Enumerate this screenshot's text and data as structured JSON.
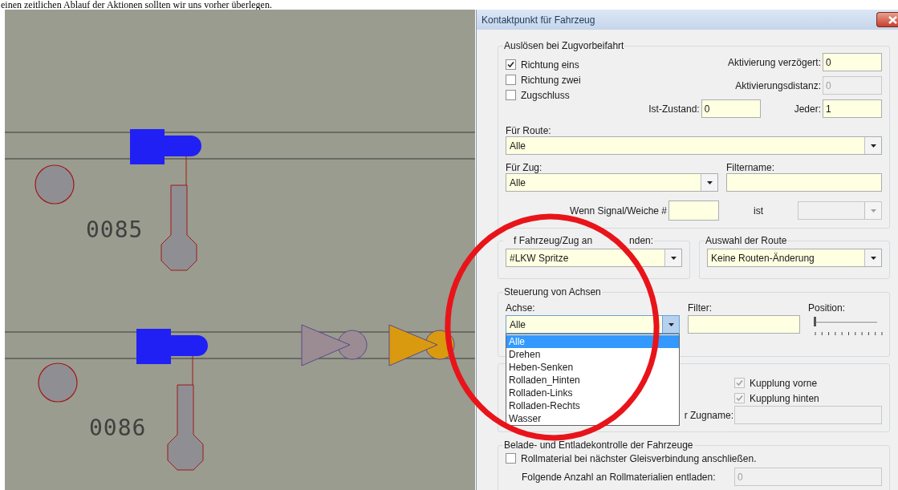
{
  "caption": "einen zeitlichen Ablauf der Aktionen sollten wir uns vorher überlegen.",
  "canvas": {
    "signals": [
      {
        "label": "0085"
      },
      {
        "label": "0086"
      }
    ],
    "markers": [
      {
        "color": "#9b8c93"
      },
      {
        "color": "#d99a10"
      }
    ]
  },
  "dialog": {
    "title": "Kontaktpunkt für Fahrzeug",
    "trigger": {
      "legend": "Auslösen bei Zugvorbeifahrt",
      "checkboxes": [
        {
          "label": "Richtung eins",
          "checked": true
        },
        {
          "label": "Richtung zwei",
          "checked": false
        },
        {
          "label": "Zugschluss",
          "checked": false
        }
      ],
      "fields": [
        {
          "label": "Aktivierung verzögert:",
          "value": "0",
          "disabled": false
        },
        {
          "label": "Aktivierungsdistanz:",
          "value": "0",
          "disabled": true
        },
        {
          "label": "Ist-Zustand:",
          "value": "0",
          "disabled": false
        },
        {
          "label": "Jeder:",
          "value": "1",
          "disabled": false
        }
      ],
      "route": {
        "label": "Für Route:",
        "value": "Alle"
      },
      "train": {
        "label": "Für Zug:",
        "value": "Alle"
      },
      "filter_name": {
        "label": "Filtername:"
      },
      "signal": {
        "label": "Wenn Signal/Weiche #",
        "state_label": "ist",
        "state_disabled": true
      }
    },
    "apply": {
      "legend_parts": [
        "f Fahrzeug/Zug an",
        "nden:"
      ],
      "value": "#LKW Spritze"
    },
    "route_choice": {
      "legend": "Auswahl der Route",
      "value": "Keine Routen-Änderung"
    },
    "axles": {
      "legend": "Steuerung von Achsen",
      "axle_label": "Achse:",
      "axle_value": "Alle",
      "expanded": true,
      "options": [
        {
          "label": "Alle",
          "selected": true
        },
        {
          "label": "Drehen",
          "selected": false
        },
        {
          "label": "Heben-Senken",
          "selected": false
        },
        {
          "label": "Rolladen_Hinten",
          "selected": false
        },
        {
          "label": "Rolladen-Links",
          "selected": false
        },
        {
          "label": "Rolladen-Rechts",
          "selected": false
        },
        {
          "label": "Wasser",
          "selected": false
        }
      ],
      "filter_label": "Filter:",
      "position_label": "Position:",
      "position": {
        "level": 0
      }
    },
    "coupling": {
      "checkboxes": [
        {
          "label": "Kupplung vorne",
          "checked": true,
          "disabled": true
        },
        {
          "label": "Kupplung hinten",
          "checked": true,
          "disabled": true
        }
      ],
      "name_label": "r Zugname:",
      "name_disabled": true
    },
    "loading": {
      "legend": "Belade- und Entladekontrolle der Fahrzeuge",
      "checkboxes": [
        {
          "label": "Rollmaterial bei nächster Gleisverbindung anschließen.",
          "checked": false
        }
      ],
      "count_label": "Folgende Anzahl an Rollmaterialien entladen:",
      "count_value": "0",
      "count_disabled": true
    }
  }
}
